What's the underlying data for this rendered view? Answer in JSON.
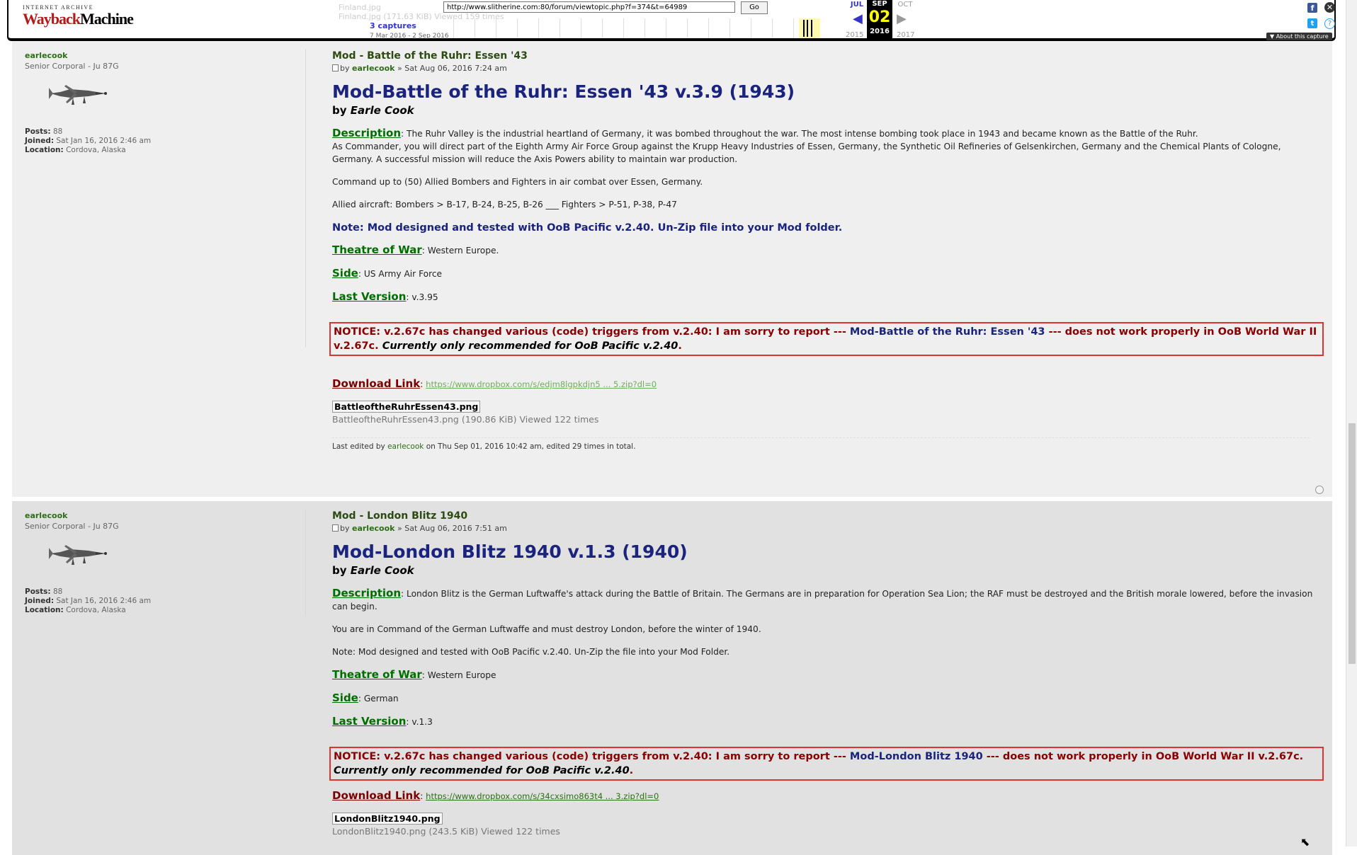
{
  "wayback": {
    "logo_top": "INTERNET ARCHIVE",
    "logo_way": "Wayback",
    "logo_machine": "Machine",
    "url": "http://www.slitherine.com:80/forum/viewtopic.php?f=374&t=64989",
    "go_label": "Go",
    "ghost_text_1": "Finland.jpg",
    "ghost_text_2": "Finland.jpg (171.63 KiB) Viewed 159 times",
    "captures": "3 captures",
    "range": "7 Mar 2016 - 2 Sep 2016",
    "prev_month": "JUL",
    "cur_month": "SEP",
    "next_month": "OCT",
    "day": "02",
    "prev_year": "2015",
    "cur_year": "2016",
    "next_year": "2017",
    "about": "▼ About this capture"
  },
  "posts": [
    {
      "profile": {
        "username": "earlecook",
        "rank": "Senior Corporal - Ju 87G",
        "posts_label": "Posts:",
        "posts": "88",
        "joined_label": "Joined:",
        "joined": "Sat Jan 16, 2016 2:46 am",
        "location_label": "Location:",
        "location": "Cordova, Alaska"
      },
      "subject": "Mod - Battle of the Ruhr: Essen '43",
      "by": "by",
      "author": "earlecook",
      "date": "» Sat Aug 06, 2016 7:24 am",
      "title": "Mod-Battle of the Ruhr: Essen '43 v.3.9 (1943)",
      "by_author_prefix": "by",
      "by_author": "Earle Cook",
      "description_label": "Description",
      "description": ": The Ruhr Valley is the industrial heartland of Germany, it was bombed throughout the war. The most intense bombing took place in 1943 and became known as the Battle of the Ruhr.",
      "description_2": "As Commander, you will direct part of the Eighth Army Air Force Group against the Krupp Heavy Industries of Essen, Germany, the Synthetic Oil Refineries of Gelsenkirchen, Germany and the Chemical Plants of Cologne, Germany. A successful mission will reduce the Axis Powers ability to maintain war production.",
      "para_1": "Command up to (50) Allied Bombers and Fighters in air combat over Essen, Germany.",
      "para_2": "Allied aircraft: Bombers > B-17, B-24, B-25, B-26 ___ Fighters > P-51, P-38, P-47",
      "note": "Note: Mod designed and tested with OoB Pacific v.2.40. Un-Zip file into your Mod folder.",
      "theatre_label": "Theatre of War",
      "theatre": ": Western Europe.",
      "side_label": "Side",
      "side": ": US Army Air Force",
      "version_label": "Last Version",
      "version": ": v.3.95",
      "notice_1": "NOTICE: v.2.67c has changed various (code) triggers from v.2.40: I am sorry to report --- ",
      "notice_mod": "Mod-Battle of the Ruhr: Essen '43",
      "notice_2": " --- does not work properly in OoB World War II v.2.67c. ",
      "notice_3": "Currently only recommended for OoB Pacific v.2.40",
      "notice_end": ".",
      "download_label": "Download Link",
      "download_sep": ": ",
      "download_url": "https://www.dropbox.com/s/edjm8lgpkdjn5 ... 5.zip?dl=0",
      "attachment": "BattleoftheRuhrEssen43.png",
      "attachment_info": "BattleoftheRuhrEssen43.png (190.86 KiB) Viewed 122 times",
      "edited_1": "Last edited by ",
      "edited_user": "earlecook",
      "edited_2": " on Thu Sep 01, 2016 10:42 am, edited 29 times in total."
    },
    {
      "profile": {
        "username": "earlecook",
        "rank": "Senior Corporal - Ju 87G",
        "posts_label": "Posts:",
        "posts": "88",
        "joined_label": "Joined:",
        "joined": "Sat Jan 16, 2016 2:46 am",
        "location_label": "Location:",
        "location": "Cordova, Alaska"
      },
      "subject": "Mod - London Blitz 1940",
      "by": "by",
      "author": "earlecook",
      "date": "» Sat Aug 06, 2016 7:51 am",
      "title": "Mod-London Blitz 1940 v.1.3 (1940)",
      "by_author_prefix": "by",
      "by_author": "Earle Cook",
      "description_label": "Description",
      "description": ": London Blitz is the German Luftwaffe's attack during the Battle of Britain. The Germans are in preparation for Operation Sea Lion; the RAF must be destroyed and the British morale lowered, before the invasion can begin.",
      "para_1": "You are in Command of the German Luftwaffe and must destroy London, before the winter of 1940.",
      "para_2": "Note: Mod designed and tested with OoB Pacific v.2.40. Un-Zip the file into your Mod Folder.",
      "theatre_label": "Theatre of War",
      "theatre": ": Western Europe",
      "side_label": "Side",
      "side": ": German",
      "version_label": "Last Version",
      "version": ": v.1.3",
      "notice_1": "NOTICE: v.2.67c has changed various (code) triggers from v.2.40: I am sorry to report --- ",
      "notice_mod": "Mod-London Blitz 1940",
      "notice_2": " --- does not work properly in OoB World War II v.2.67c. ",
      "notice_3": "Currently only recommended for OoB Pacific v.2.40",
      "notice_end": ".",
      "download_label": "Download Link",
      "download_sep": ": ",
      "download_url": "https://www.dropbox.com/s/34cxsimo863t4 ... 3.zip?dl=0",
      "attachment": "LondonBlitz1940.png",
      "attachment_info": "LondonBlitz1940.png (243.5 KiB) Viewed 122 times"
    }
  ],
  "icons": {
    "facebook": "f",
    "twitter": "t",
    "close": "✕",
    "help": "?"
  },
  "colors": {
    "title_blue": "#1a237e",
    "label_green": "#006d00",
    "notice_red": "#8b0000"
  }
}
